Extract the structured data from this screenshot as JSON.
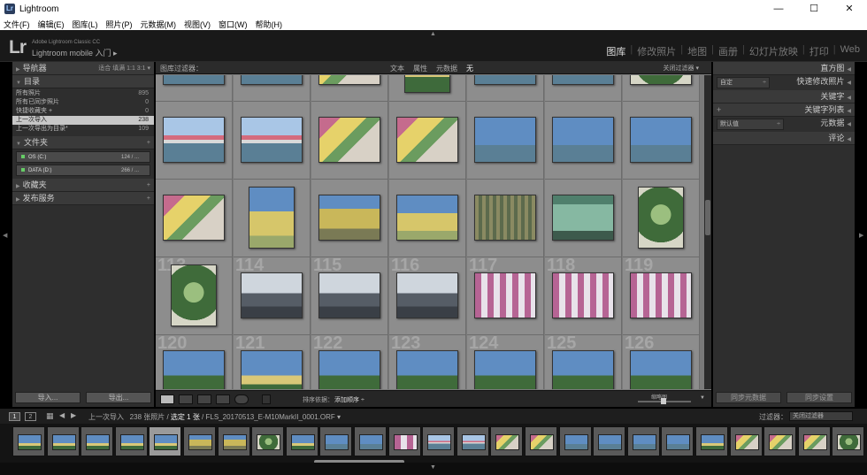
{
  "window": {
    "title": "Lightroom",
    "controls": {
      "minimize": "—",
      "maximize": "☐",
      "close": "✕"
    }
  },
  "menu": [
    "文件(F)",
    "编辑(E)",
    "图库(L)",
    "照片(P)",
    "元数据(M)",
    "视图(V)",
    "窗口(W)",
    "帮助(H)"
  ],
  "identity": {
    "logo": "Lr",
    "line1": "Adobe Lightroom Classic CC",
    "line2": "Lightroom mobile 入门  ▸"
  },
  "modules": [
    "图库",
    "修改照片",
    "地图",
    "画册",
    "幻灯片放映",
    "打印",
    "Web"
  ],
  "active_module": "图库",
  "navigator": {
    "title": "导航器",
    "options": "适合  填满  1:1  3:1 ▾"
  },
  "catalog": {
    "title": "目录",
    "items": [
      {
        "label": "所有照片",
        "count": "895"
      },
      {
        "label": "所有已同步照片",
        "count": "0"
      },
      {
        "label": "快捷收藏夹 +",
        "count": "0"
      },
      {
        "label": "上一次导入",
        "count": "238"
      },
      {
        "label": "上一次导出为目录*",
        "count": "109"
      }
    ]
  },
  "folders": {
    "title": "文件夹",
    "volumes": [
      {
        "label": "OS (C:)",
        "pct": "124 / ..."
      },
      {
        "label": "DATA (D:)",
        "pct": "266 / ..."
      }
    ]
  },
  "collections": {
    "title": "收藏夹"
  },
  "publish": {
    "title": "发布服务"
  },
  "left_buttons": {
    "import": "导入...",
    "export": "导出..."
  },
  "filter_bar": {
    "title": "图库过滤器：",
    "options": [
      "文本",
      "属性",
      "元数据",
      "无"
    ],
    "active": "无",
    "right": "关闭过滤器 ▾"
  },
  "grid": {
    "row_numbers": [
      [
        "",
        "",
        "",
        "",
        "",
        "",
        ""
      ],
      [
        "",
        "",
        "",
        "",
        "",
        "",
        ""
      ],
      [
        "",
        "",
        "",
        "",
        "",
        "",
        ""
      ],
      [
        "113",
        "114",
        "115",
        "116",
        "117",
        "118",
        "119"
      ],
      [
        "120",
        "121",
        "122",
        "123",
        "124",
        "125",
        "126"
      ]
    ]
  },
  "toolbar": {
    "sort_label": "排序依据：",
    "sort_value": "添加顺序 ÷",
    "zoom_label": "缩略图"
  },
  "right_panel": {
    "histogram": "直方图",
    "quick_develop": "快速修改照片",
    "quick_preset": "自定",
    "keywording": "关键字",
    "keyword_list": "关键字列表",
    "metadata": "元数据",
    "metadata_preset": "默认值",
    "comments": "评论",
    "sync_metadata": "同步元数据",
    "sync_settings": "同步设置"
  },
  "filmstrip_bar": {
    "page1": "1",
    "page2": "2",
    "source": "上一次导入",
    "count_text": "238 张照片 / ",
    "selected_text": "选定 1 张",
    "file_text": " / FLS_20170513_E-M10MarkII_0001.ORF ▾",
    "filter_label": "过滤器：",
    "filter_value": "关闭过滤器"
  },
  "colors": {
    "sky": "#5f8dc2",
    "water": "#5a7f95",
    "arch_pink": "#c56b8d",
    "yellow_bld": "#c9b75a",
    "green": "#3f6b3a",
    "cloud": "#cfd6dd"
  }
}
